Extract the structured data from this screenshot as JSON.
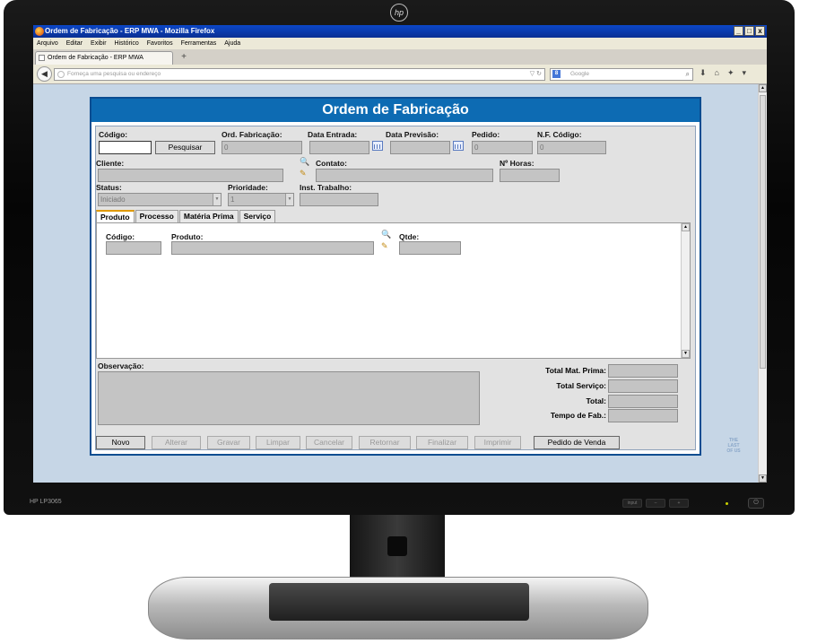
{
  "browser": {
    "window_title": "Ordem de Fabricação - ERP MWA - Mozilla Firefox",
    "menu": [
      "Arquivo",
      "Editar",
      "Exibir",
      "Histórico",
      "Favoritos",
      "Ferramentas",
      "Ajuda"
    ],
    "tab_title": "Ordem de Fabricação - ERP MWA",
    "new_tab": "+",
    "url_placeholder": "Forneça uma pesquisa ou endereço",
    "search_placeholder": "Google",
    "search_engine_letter": "8",
    "window_buttons": {
      "minimize": "_",
      "maximize": "□",
      "close": "x"
    }
  },
  "monitor": {
    "brand": "hp",
    "model": "HP LP3065",
    "button_labels": [
      "input",
      "–",
      "+"
    ],
    "watermark": "THE LAST OF US"
  },
  "form": {
    "title": "Ordem de Fabricação",
    "fields": {
      "codigo": {
        "label": "Código:",
        "value": ""
      },
      "pesquisar": "Pesquisar",
      "ord_fabricacao": {
        "label": "Ord. Fabricação:",
        "value": "0"
      },
      "data_entrada": {
        "label": "Data Entrada:",
        "value": ""
      },
      "data_previsao": {
        "label": "Data Previsão:",
        "value": ""
      },
      "pedido": {
        "label": "Pedido:",
        "value": "0"
      },
      "nf_codigo": {
        "label": "N.F. Código:",
        "value": "0"
      },
      "cliente": {
        "label": "Cliente:",
        "value": ""
      },
      "contato": {
        "label": "Contato:",
        "value": ""
      },
      "n_horas": {
        "label": "Nº Horas:",
        "value": ""
      },
      "status": {
        "label": "Status:",
        "value": "Iniciado"
      },
      "prioridade": {
        "label": "Prioridade:",
        "value": "1"
      },
      "inst_trabalho": {
        "label": "Inst. Trabalho:",
        "value": ""
      }
    },
    "tabs": [
      "Produto",
      "Processo",
      "Matéria Prima",
      "Serviço"
    ],
    "produto_tab": {
      "codigo_label": "Código:",
      "produto_label": "Produto:",
      "qtde_label": "Qtde:"
    },
    "observacao_label": "Observação:",
    "totals": [
      {
        "label": "Total Mat. Prima:",
        "value": ""
      },
      {
        "label": "Total Serviço:",
        "value": ""
      },
      {
        "label": "Total:",
        "value": ""
      },
      {
        "label": "Tempo de Fab.:",
        "value": ""
      }
    ],
    "buttons": [
      {
        "label": "Novo",
        "enabled": true
      },
      {
        "label": "Alterar",
        "enabled": false
      },
      {
        "label": "Gravar",
        "enabled": false
      },
      {
        "label": "Limpar",
        "enabled": false
      },
      {
        "label": "Cancelar",
        "enabled": false
      },
      {
        "label": "Retornar",
        "enabled": false
      },
      {
        "label": "Finalizar",
        "enabled": false
      },
      {
        "label": "Imprimir",
        "enabled": false
      },
      {
        "label": "Pedido de Venda",
        "enabled": true
      }
    ]
  },
  "colors": {
    "header_blue": "#0d6bb3",
    "titlebar_blue": "#0b47c8",
    "page_bg": "#c6d6e6",
    "disabled_field": "#c4c4c4",
    "active_tab_accent": "#e09a00"
  }
}
